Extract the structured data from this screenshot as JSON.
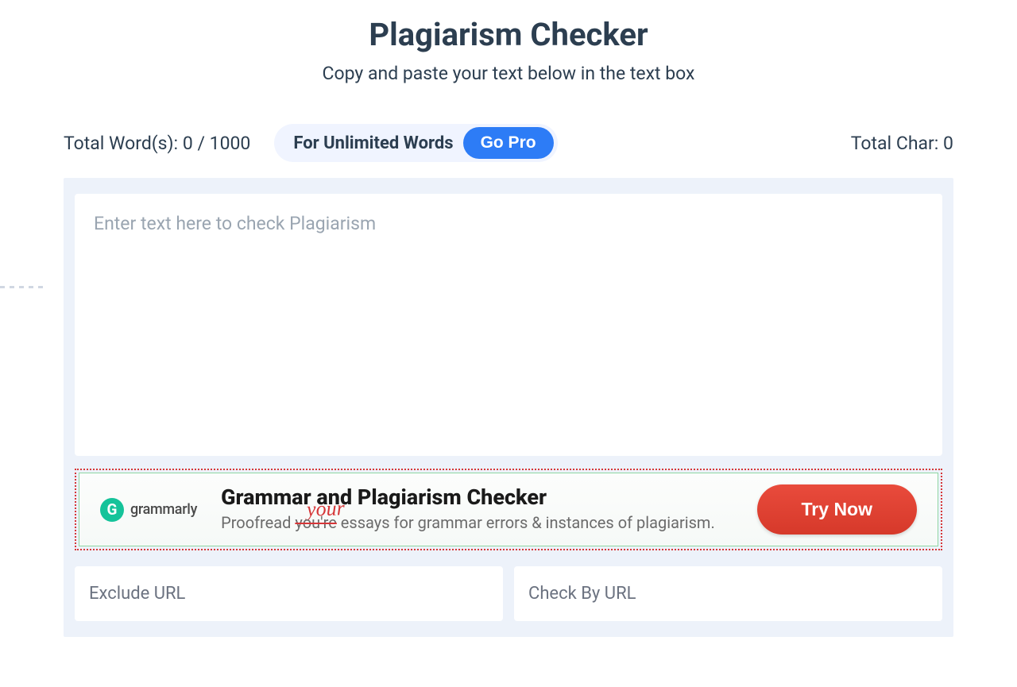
{
  "header": {
    "title": "Plagiarism Checker",
    "subtitle": "Copy and paste your text below in the text box"
  },
  "stats": {
    "word_count_label": "Total Word(s): 0 / 1000",
    "char_count_label": "Total Char: 0",
    "unlimited_text": "For Unlimited Words",
    "go_pro_label": "Go Pro"
  },
  "editor": {
    "placeholder": "Enter text here to check Plagiarism"
  },
  "ad": {
    "brand_name": "grammarly",
    "title": "Grammar and Plagiarism Checker",
    "body_prefix": "Proofread ",
    "body_strike": "you're",
    "body_handwritten": "your",
    "body_suffix": " essays for grammar errors & instances of plagiarism.",
    "cta_label": "Try Now"
  },
  "bottom": {
    "exclude_url_placeholder": "Exclude URL",
    "check_by_url_placeholder": "Check By URL"
  }
}
